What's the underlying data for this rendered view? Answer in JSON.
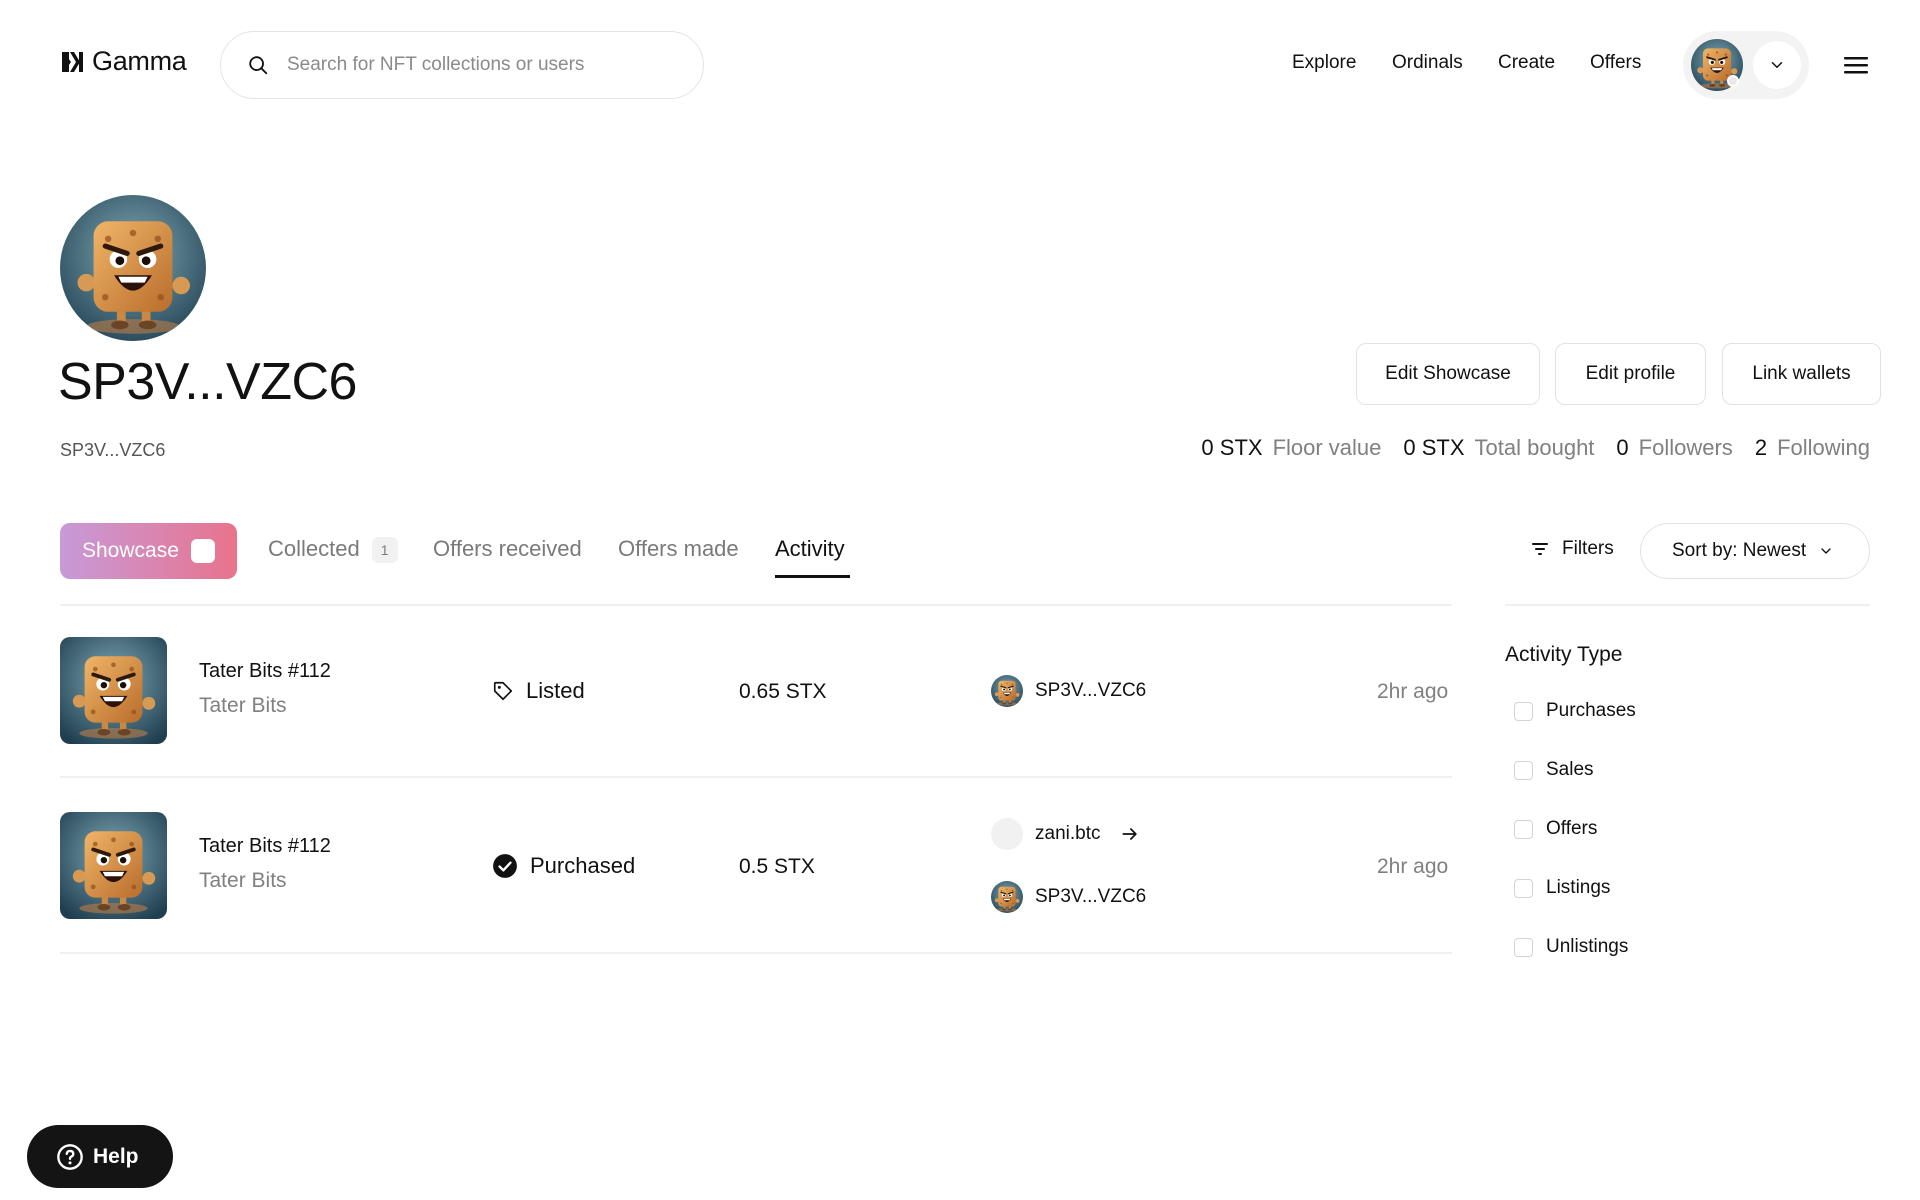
{
  "header": {
    "logo_text": "Gamma",
    "search_placeholder": "Search for NFT collections or users",
    "nav": [
      "Explore",
      "Ordinals",
      "Create",
      "Offers"
    ]
  },
  "profile": {
    "name": "SP3V...VZC6",
    "address": "SP3V...VZC6",
    "buttons": {
      "edit_showcase": "Edit Showcase",
      "edit_profile": "Edit profile",
      "link_wallets": "Link wallets"
    },
    "stats": [
      {
        "value": "0 STX",
        "label": "Floor value"
      },
      {
        "value": "0 STX",
        "label": "Total bought"
      },
      {
        "value": "0",
        "label": "Followers"
      },
      {
        "value": "2",
        "label": "Following"
      }
    ]
  },
  "tabs": {
    "showcase": "Showcase",
    "collected": "Collected",
    "collected_count": "1",
    "offers_received": "Offers received",
    "offers_made": "Offers made",
    "activity": "Activity",
    "active": "Activity"
  },
  "toolbar": {
    "filters": "Filters",
    "sort": "Sort by: Newest"
  },
  "activity": [
    {
      "item": "Tater Bits #112",
      "collection": "Tater Bits",
      "event": "Listed",
      "event_icon": "tag-icon",
      "price": "0.65 STX",
      "from": "SP3V...VZC6",
      "to": null,
      "time": "2hr ago"
    },
    {
      "item": "Tater Bits #112",
      "collection": "Tater Bits",
      "event": "Purchased",
      "event_icon": "check-circle-icon",
      "price": "0.5 STX",
      "from": "zani.btc",
      "to": "SP3V...VZC6",
      "time": "2hr ago"
    }
  ],
  "filter_panel": {
    "title": "Activity Type",
    "options": [
      "Purchases",
      "Sales",
      "Offers",
      "Listings",
      "Unlistings"
    ]
  },
  "help": {
    "label": "Help"
  },
  "colors": {
    "text": "#111111",
    "muted": "#808080",
    "border": "#e2e2e2",
    "showcase_gradient_start": "#c79ad9",
    "showcase_gradient_end": "#e9738c",
    "help_bg": "#141414"
  }
}
